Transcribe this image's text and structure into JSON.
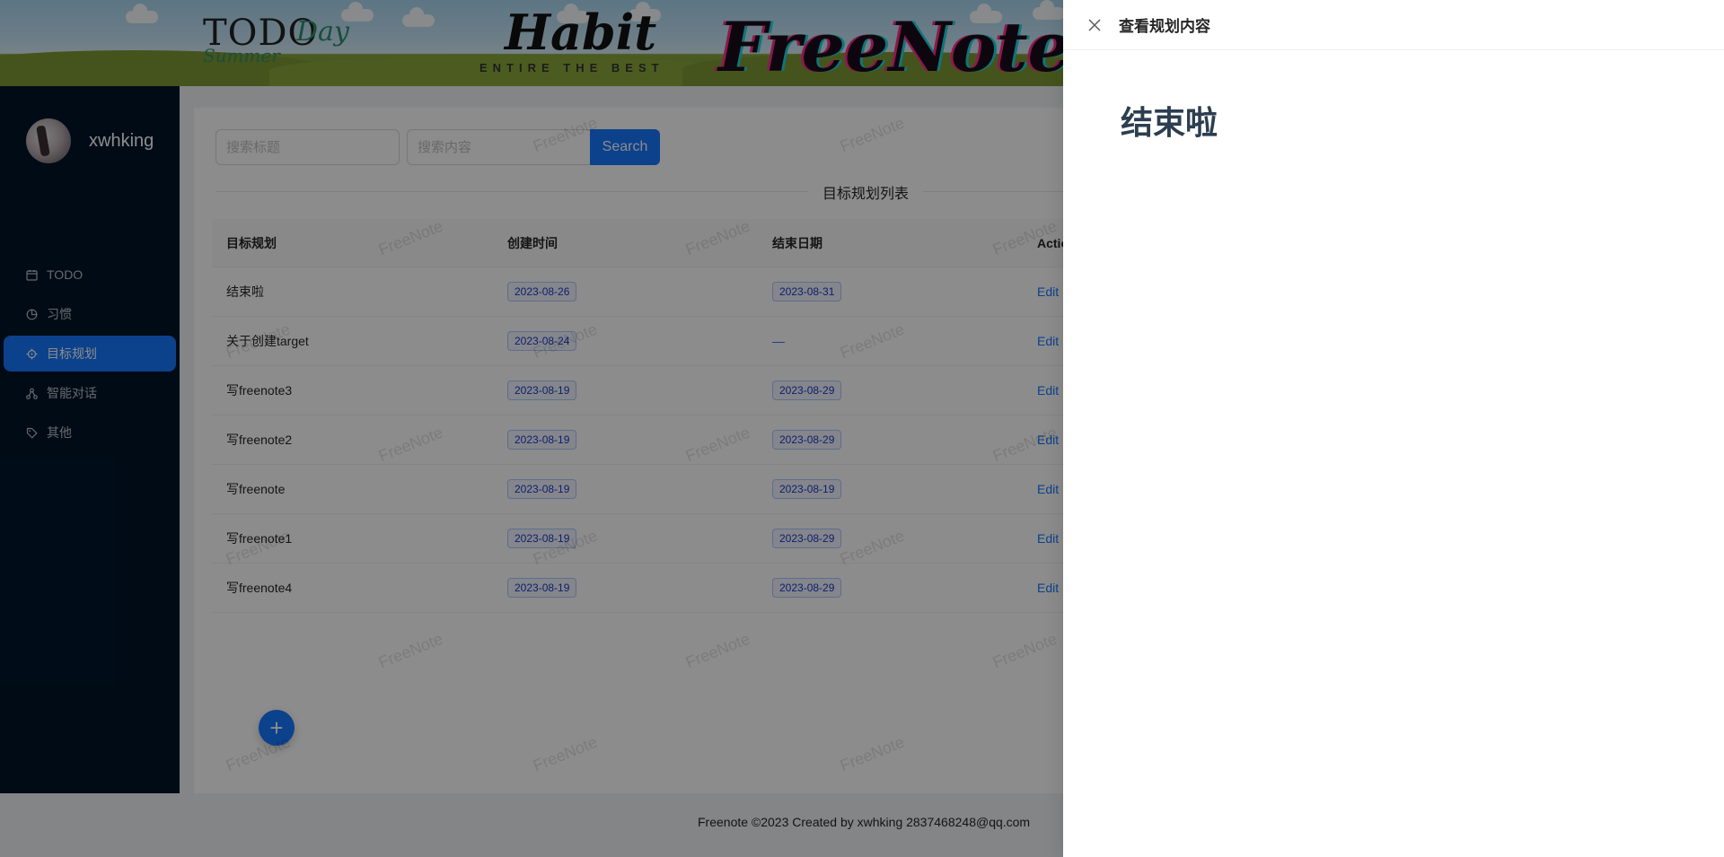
{
  "header": {
    "logo_todo": "TODO",
    "logo_day": "Day",
    "logo_summer": "Summer",
    "logo_habit": "Habit",
    "logo_habit_sub": "ENTIRE THE BEST",
    "logo_freenote": "FreeNote"
  },
  "user": {
    "name": "xwhking"
  },
  "sidebar": {
    "items": [
      {
        "label": "TODO",
        "icon": "calendar-icon"
      },
      {
        "label": "习惯",
        "icon": "pie-chart-icon"
      },
      {
        "label": "目标规划",
        "icon": "aim-icon",
        "active": true
      },
      {
        "label": "智能对话",
        "icon": "cluster-icon"
      },
      {
        "label": "其他",
        "icon": "tag-icon"
      }
    ]
  },
  "search": {
    "title_placeholder": "搜索标题",
    "content_placeholder": "搜索内容",
    "button_label": "Search"
  },
  "list": {
    "title": "目标规划列表",
    "columns": [
      "目标规划",
      "创建时间",
      "结束日期",
      "Action"
    ],
    "rows": [
      {
        "name": "结束啦",
        "created": "2023-08-26",
        "end": "2023-08-31",
        "action": "Edit"
      },
      {
        "name": "关于创建target",
        "created": "2023-08-24",
        "end": "—",
        "action": "Edit"
      },
      {
        "name": "写freenote3",
        "created": "2023-08-19",
        "end": "2023-08-29",
        "action": "Edit"
      },
      {
        "name": "写freenote2",
        "created": "2023-08-19",
        "end": "2023-08-29",
        "action": "Edit"
      },
      {
        "name": "写freenote",
        "created": "2023-08-19",
        "end": "2023-08-19",
        "action": "Edit"
      },
      {
        "name": "写freenote1",
        "created": "2023-08-19",
        "end": "2023-08-29",
        "action": "Edit"
      },
      {
        "name": "写freenote4",
        "created": "2023-08-19",
        "end": "2023-08-29",
        "action": "Edit"
      }
    ]
  },
  "fab": {
    "label": "+"
  },
  "watermark": "FreeNote",
  "footer": {
    "text": "Freenote ©2023 Created by xwhking 2837468248@qq.com"
  },
  "drawer": {
    "title": "查看规划内容",
    "heading": "结束啦"
  },
  "colors": {
    "primary": "#1677ff",
    "sidebar_bg": "#001529",
    "tag_text": "#1d39c4"
  }
}
